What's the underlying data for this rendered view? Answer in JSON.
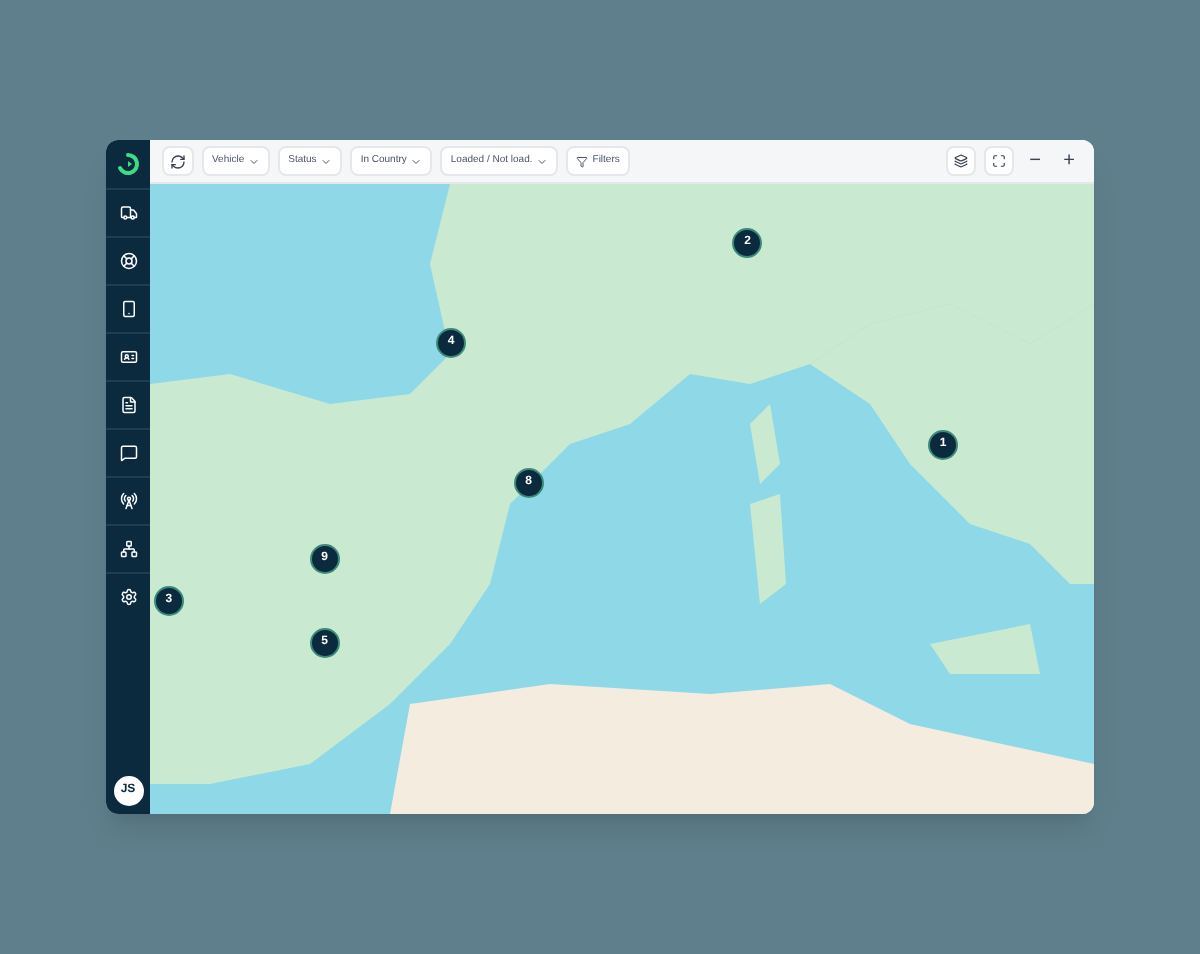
{
  "toolbar": {
    "filters": [
      {
        "label": "Vehicle"
      },
      {
        "label": "Status"
      },
      {
        "label": "In Country"
      },
      {
        "label": "Loaded / Not load."
      }
    ],
    "filters_button": "Filters",
    "zoom_out": "−",
    "zoom_in": "+"
  },
  "sidebar": {
    "items": [
      {
        "kind": "truck",
        "selected": false
      },
      {
        "kind": "wheel",
        "selected": false
      },
      {
        "kind": "phone",
        "selected": false
      },
      {
        "kind": "card",
        "selected": false
      },
      {
        "kind": "file",
        "selected": false
      },
      {
        "kind": "message",
        "selected": false
      },
      {
        "kind": "antenna",
        "selected": false
      },
      {
        "kind": "network",
        "selected": false
      },
      {
        "kind": "settings",
        "selected": false
      }
    ],
    "avatar": "JS"
  },
  "markers": [
    {
      "count": "2"
    },
    {
      "count": "4"
    },
    {
      "count": "1"
    },
    {
      "count": "8"
    },
    {
      "count": "9"
    },
    {
      "count": "3"
    },
    {
      "count": "5"
    }
  ]
}
